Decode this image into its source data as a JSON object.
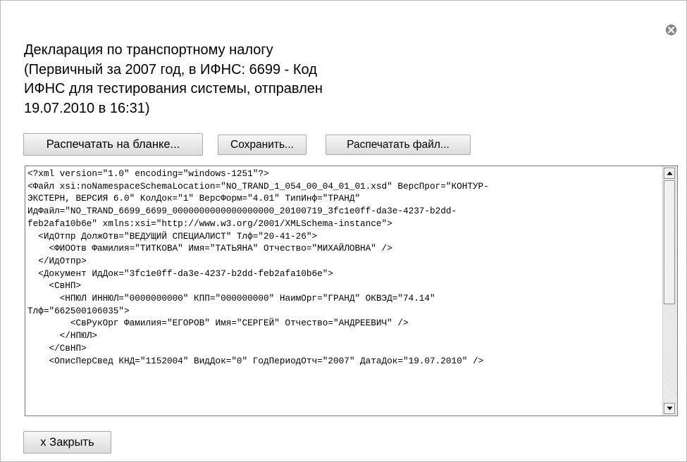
{
  "dialog": {
    "title_lines": [
      "Декларация по транспортному налогу",
      "(Первичный за 2007 год, в ИФНС: 6699 - Код",
      "ИФНС для тестирования системы, отправлен",
      "19.07.2010 в 16:31)"
    ],
    "close_icon": "close-circle-icon"
  },
  "toolbar": {
    "print_form_label": "Распечатать на бланке...",
    "save_label": "Сохранить...",
    "print_file_label": "Распечатать файл..."
  },
  "xml_viewer": {
    "lines": [
      "<?xml version=\"1.0\" encoding=\"windows-1251\"?>",
      "<Файл xsi:noNamespaceSchemaLocation=\"NO_TRAND_1_054_00_04_01_01.xsd\" ВерсПрог=\"КОНТУР-",
      "ЭКСТЕРН, ВЕРСИЯ 6.0\" КолДок=\"1\" ВерсФорм=\"4.01\" ТипИнф=\"ТРАНД\"",
      "ИдФайл=\"NO_TRAND_6699_6699_0000000000000000000_20100719_3fc1e0ff-da3e-4237-b2dd-",
      "feb2afa10b6e\" xmlns:xsi=\"http://www.w3.org/2001/XMLSchema-instance\">",
      "  <ИдОтпр ДолжОтв=\"ВЕДУЩИЙ СПЕЦИАЛИСТ\" Тлф=\"20-41-26\">",
      "    <ФИООтв Фамилия=\"ТИТКОВА\" Имя=\"ТАТЬЯНА\" Отчество=\"МИХАЙЛОВНА\" />",
      "  </ИдОтпр>",
      "  <Документ ИдДок=\"3fc1e0ff-da3e-4237-b2dd-feb2afa10b6e\">",
      "    <СвНП>",
      "      <НПЮЛ ИННЮЛ=\"0000000000\" КПП=\"000000000\" НаимОрг=\"ГРАНД\" ОКВЭД=\"74.14\"",
      "Тлф=\"662500106035\">",
      "        <СвРукОрг Фамилия=\"ЕГОРОВ\" Имя=\"СЕРГЕЙ\" Отчество=\"АНДРЕЕВИЧ\" />",
      "      </НПЮЛ>",
      "    </СвНП>",
      "    <ОписПерСвед КНД=\"1152004\" ВидДок=\"0\" ГодПериодОтч=\"2007\" ДатаДок=\"19.07.2010\" />"
    ],
    "scroll_up_icon": "scroll-up-arrow-icon",
    "scroll_down_icon": "scroll-down-arrow-icon"
  },
  "footer": {
    "close_label": "x Закрыть"
  }
}
